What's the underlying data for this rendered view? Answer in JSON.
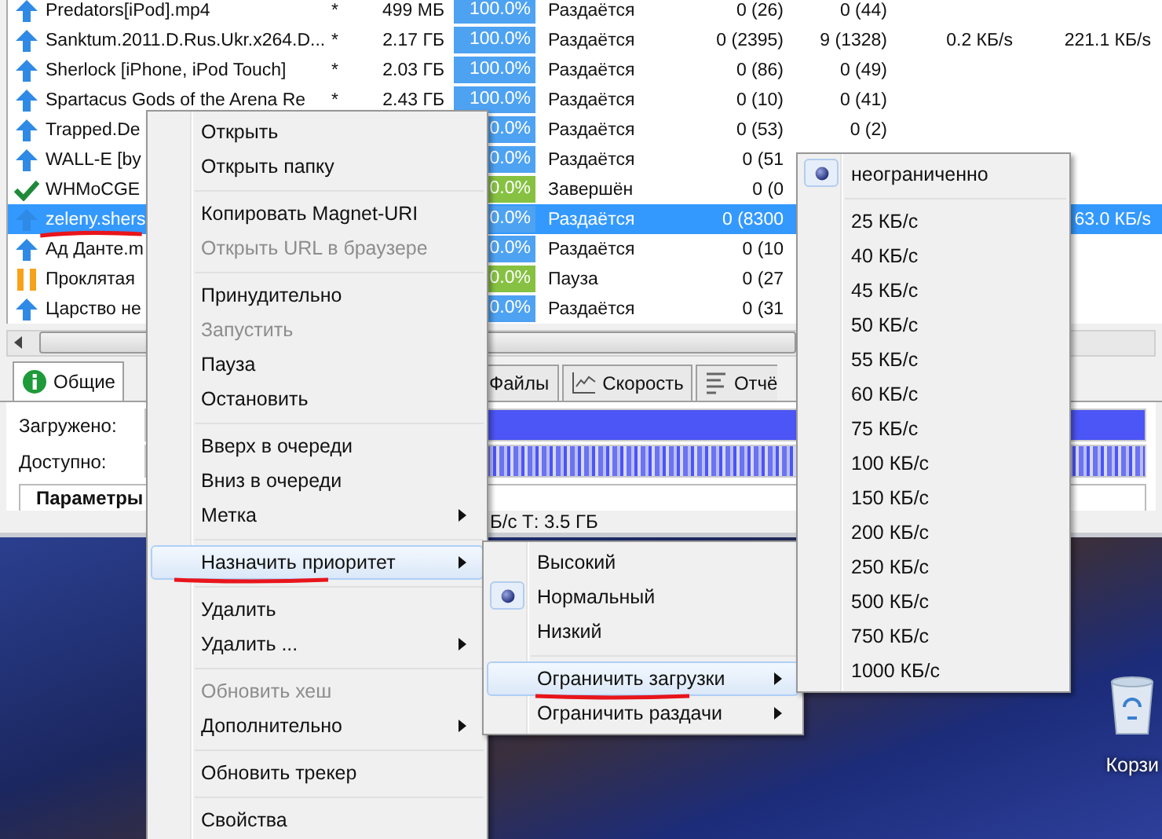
{
  "table": {
    "rows": [
      {
        "kind": "seeding",
        "name": "Predators[iPod].mp4",
        "star": "*",
        "size": "499 МБ",
        "progress": "100.0%",
        "status": "Раздаётся",
        "seeds": "0 (26)",
        "peers": "0 (44)",
        "selected": false,
        "underlined": false
      },
      {
        "kind": "seeding",
        "name": "Sanktum.2011.D.Rus.Ukr.x264.D...",
        "star": "*",
        "size": "2.17 ГБ",
        "progress": "100.0%",
        "status": "Раздаётся",
        "seeds": "0 (2395)",
        "peers": "9 (1328)",
        "down": "0.2 КБ/s",
        "up": "221.1 КБ/s",
        "selected": false,
        "underlined": false
      },
      {
        "kind": "seeding",
        "name": "Sherlock [iPhone, iPod Touch]",
        "star": "*",
        "size": "2.03 ГБ",
        "progress": "100.0%",
        "status": "Раздаётся",
        "seeds": "0 (86)",
        "peers": "0 (49)",
        "selected": false,
        "underlined": false
      },
      {
        "kind": "seeding",
        "name": "Spartacus Gods of the Arena Re",
        "star": "*",
        "size": "2.43 ГБ",
        "progress": "100.0%",
        "status": "Раздаётся",
        "seeds": "0 (10)",
        "peers": "0 (41)",
        "selected": false,
        "underlined": false
      },
      {
        "kind": "seeding",
        "name": "Trapped.De",
        "progress": "0.0%",
        "status": "Раздаётся",
        "seeds": "0 (53)",
        "peers": "0 (2)",
        "selected": false,
        "underlined": false
      },
      {
        "kind": "seeding",
        "name": "WALL-E [by",
        "progress": "0.0%",
        "status": "Раздаётся",
        "seeds": "0 (51",
        "selected": false,
        "underlined": false
      },
      {
        "kind": "finished",
        "name": "WHMoCGE",
        "progress": "0.0%",
        "status": "Завершён",
        "seeds": "0 (0",
        "selected": false,
        "underlined": false
      },
      {
        "kind": "seeding",
        "name": "zeleny.shers",
        "progress": "0.0%",
        "status": "Раздаётся",
        "seeds": "0 (8300",
        "up": "63.0 КБ/s",
        "selected": true,
        "underlined": true
      },
      {
        "kind": "seeding",
        "name": "Ад Данте.m",
        "progress": "0.0%",
        "status": "Раздаётся",
        "seeds": "0 (10",
        "selected": false,
        "underlined": false
      },
      {
        "kind": "paused",
        "name": "Проклятая",
        "progress": "0.0%",
        "status": "Пауза",
        "seeds": "0 (27",
        "selected": false,
        "underlined": false
      },
      {
        "kind": "seeding",
        "name": "Царство не",
        "progress": "0.0%",
        "status": "Раздаётся",
        "seeds": "0 (31",
        "selected": false,
        "underlined": false
      }
    ]
  },
  "tabs": [
    {
      "kind": "info",
      "label": "Общие",
      "selected": true
    },
    {
      "kind": "plain",
      "label": "Файлы",
      "selected": false
    },
    {
      "kind": "speed",
      "label": "Скорость",
      "selected": false
    },
    {
      "kind": "log",
      "label": "Отчё",
      "selected": false
    }
  ],
  "details": {
    "downloaded_label": "Загружено:",
    "available_label": "Доступно:",
    "section_title": "Параметры"
  },
  "status_bar": {
    "text": "Б/с Т: 3.5 ГБ"
  },
  "desktop": {
    "icons": [
      {
        "label": "Корзи"
      }
    ]
  },
  "context_menu": {
    "items": [
      {
        "kind": "command",
        "label": "Открыть",
        "disabled": false,
        "highlighted": false,
        "underlined": false
      },
      {
        "kind": "command",
        "label": "Открыть папку",
        "disabled": false,
        "highlighted": false,
        "underlined": false
      },
      {
        "kind": "separator"
      },
      {
        "kind": "command",
        "label": "Копировать Magnet-URI",
        "disabled": false,
        "highlighted": false,
        "underlined": false
      },
      {
        "kind": "command",
        "label": "Открыть URL в браузере",
        "disabled": true,
        "highlighted": false,
        "underlined": false
      },
      {
        "kind": "separator"
      },
      {
        "kind": "command",
        "label": "Принудительно",
        "disabled": false,
        "highlighted": false,
        "underlined": false
      },
      {
        "kind": "command",
        "label": "Запустить",
        "disabled": true,
        "highlighted": false,
        "underlined": false
      },
      {
        "kind": "command",
        "label": "Пауза",
        "disabled": false,
        "highlighted": false,
        "underlined": false
      },
      {
        "kind": "command",
        "label": "Остановить",
        "disabled": false,
        "highlighted": false,
        "underlined": false
      },
      {
        "kind": "separator"
      },
      {
        "kind": "command",
        "label": "Вверх в очереди",
        "disabled": false,
        "highlighted": false,
        "underlined": false
      },
      {
        "kind": "command",
        "label": "Вниз в очереди",
        "disabled": false,
        "highlighted": false,
        "underlined": false
      },
      {
        "kind": "submenu",
        "label": "Метка",
        "disabled": false,
        "highlighted": false,
        "underlined": false
      },
      {
        "kind": "separator"
      },
      {
        "kind": "submenu",
        "label": "Назначить приоритет",
        "disabled": false,
        "highlighted": true,
        "underlined": true
      },
      {
        "kind": "separator"
      },
      {
        "kind": "command",
        "label": "Удалить",
        "disabled": false,
        "highlighted": false,
        "underlined": false
      },
      {
        "kind": "submenu",
        "label": "Удалить ...",
        "disabled": false,
        "highlighted": false,
        "underlined": false
      },
      {
        "kind": "separator"
      },
      {
        "kind": "command",
        "label": "Обновить хеш",
        "disabled": true,
        "highlighted": false,
        "underlined": false
      },
      {
        "kind": "submenu",
        "label": "Дополнительно",
        "disabled": false,
        "highlighted": false,
        "underlined": false
      },
      {
        "kind": "separator"
      },
      {
        "kind": "command",
        "label": "Обновить трекер",
        "disabled": false,
        "highlighted": false,
        "underlined": false
      },
      {
        "kind": "separator"
      },
      {
        "kind": "command",
        "label": "Свойства",
        "disabled": false,
        "highlighted": false,
        "underlined": false
      }
    ]
  },
  "priority_submenu": {
    "items": [
      {
        "kind": "radio",
        "label": "Высокий",
        "checked": false,
        "disabled": false,
        "highlighted": false,
        "underlined": false
      },
      {
        "kind": "radio",
        "label": "Нормальный",
        "checked": true,
        "disabled": false,
        "highlighted": false,
        "underlined": false
      },
      {
        "kind": "radio",
        "label": "Низкий",
        "checked": false,
        "disabled": false,
        "highlighted": false,
        "underlined": false
      },
      {
        "kind": "separator"
      },
      {
        "kind": "submenu",
        "label": "Ограничить загрузки",
        "disabled": false,
        "highlighted": true,
        "underlined": true
      },
      {
        "kind": "submenu",
        "label": "Ограничить раздачи",
        "disabled": false,
        "highlighted": false,
        "underlined": false
      }
    ]
  },
  "download_limit_submenu": {
    "items": [
      {
        "kind": "radio",
        "label": "неограниченно",
        "checked": true,
        "disabled": false,
        "highlighted": false,
        "underlined": false
      },
      {
        "kind": "separator"
      },
      {
        "kind": "radio",
        "label": "25 КБ/с",
        "checked": false,
        "disabled": false,
        "highlighted": false,
        "underlined": false
      },
      {
        "kind": "radio",
        "label": "40 КБ/с",
        "checked": false,
        "disabled": false,
        "highlighted": false,
        "underlined": false
      },
      {
        "kind": "radio",
        "label": "45 КБ/с",
        "checked": false,
        "disabled": false,
        "highlighted": false,
        "underlined": false
      },
      {
        "kind": "radio",
        "label": "50 КБ/с",
        "checked": false,
        "disabled": false,
        "highlighted": false,
        "underlined": false
      },
      {
        "kind": "radio",
        "label": "55 КБ/с",
        "checked": false,
        "disabled": false,
        "highlighted": false,
        "underlined": false
      },
      {
        "kind": "radio",
        "label": "60 КБ/с",
        "checked": false,
        "disabled": false,
        "highlighted": false,
        "underlined": false
      },
      {
        "kind": "radio",
        "label": "75 КБ/с",
        "checked": false,
        "disabled": false,
        "highlighted": false,
        "underlined": false
      },
      {
        "kind": "radio",
        "label": "100 КБ/с",
        "checked": false,
        "disabled": false,
        "highlighted": false,
        "underlined": false
      },
      {
        "kind": "radio",
        "label": "150 КБ/с",
        "checked": false,
        "disabled": false,
        "highlighted": false,
        "underlined": false
      },
      {
        "kind": "radio",
        "label": "200 КБ/с",
        "checked": false,
        "disabled": false,
        "highlighted": false,
        "underlined": false
      },
      {
        "kind": "radio",
        "label": "250 КБ/с",
        "checked": false,
        "disabled": false,
        "highlighted": false,
        "underlined": false
      },
      {
        "kind": "radio",
        "label": "500 КБ/с",
        "checked": false,
        "disabled": false,
        "highlighted": false,
        "underlined": false
      },
      {
        "kind": "radio",
        "label": "750 КБ/с",
        "checked": false,
        "disabled": false,
        "highlighted": false,
        "underlined": false
      },
      {
        "kind": "radio",
        "label": "1000 КБ/с",
        "checked": false,
        "disabled": false,
        "highlighted": false,
        "underlined": false
      }
    ]
  }
}
